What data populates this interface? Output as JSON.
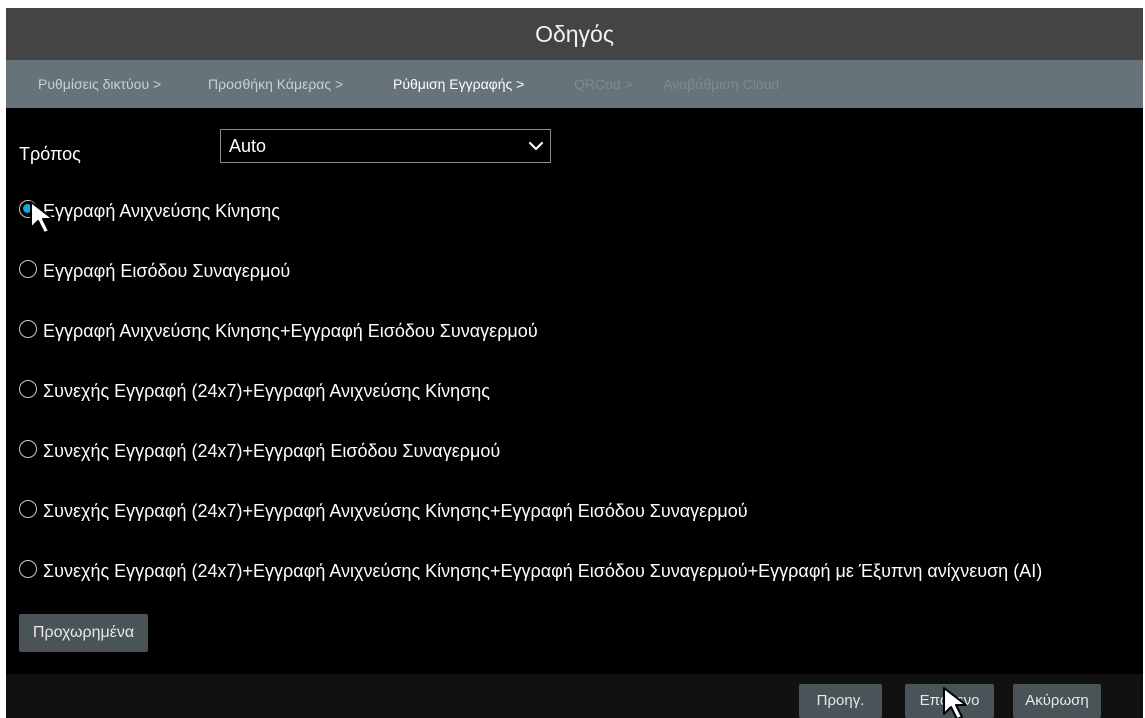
{
  "window": {
    "title": "Οδηγός"
  },
  "breadcrumb": [
    {
      "label": "Ρυθμίσεις δικτύου >",
      "state": "done"
    },
    {
      "label": "Προσθήκη Κάμερας >",
      "state": "done"
    },
    {
      "label": "Ρύθμιση Εγγραφής >",
      "state": "active"
    },
    {
      "label": "QRCod >",
      "state": "disabled"
    },
    {
      "label": "Αναβάθμιση Cloud",
      "state": "disabled"
    }
  ],
  "mode": {
    "label": "Τρόπος",
    "selected": "Auto",
    "icon": "chevron-down-icon"
  },
  "record_options": [
    {
      "label": "Εγγραφή Ανιχνεύσης Κίνησης",
      "selected": true
    },
    {
      "label": "Εγγραφή Εισόδου Συναγερμού",
      "selected": false
    },
    {
      "label": "Εγγραφή Ανιχνεύσης Κίνησης+Εγγραφή Εισόδου Συναγερμού",
      "selected": false
    },
    {
      "label": "Συνεχής Εγγραφή (24x7)+Εγγραφή Ανιχνεύσης Κίνησης",
      "selected": false
    },
    {
      "label": "Συνεχής Εγγραφή (24x7)+Εγγραφή Εισόδου Συναγερμού",
      "selected": false
    },
    {
      "label": "Συνεχής Εγγραφή (24x7)+Εγγραφή Ανιχνεύσης Κίνησης+Εγγραφή Εισόδου Συναγερμού",
      "selected": false
    },
    {
      "label": "Συνεχής Εγγραφή (24x7)+Εγγραφή Ανιχνεύσης Κίνησης+Εγγραφή Εισόδου Συναγερμού+Εγγραφή με Έξυπνη ανίχνευση (AI)",
      "selected": false
    }
  ],
  "advanced_button": "Προχωρημένα",
  "footer": {
    "prev": "Προηγ.",
    "next": "Επόμενο",
    "cancel": "Ακύρωση"
  },
  "colors": {
    "title_bar": "#444444",
    "breadcrumb_bar": "#667479",
    "background": "#000000",
    "radio_selected": "#14a9dc",
    "button": "#4a5357"
  }
}
